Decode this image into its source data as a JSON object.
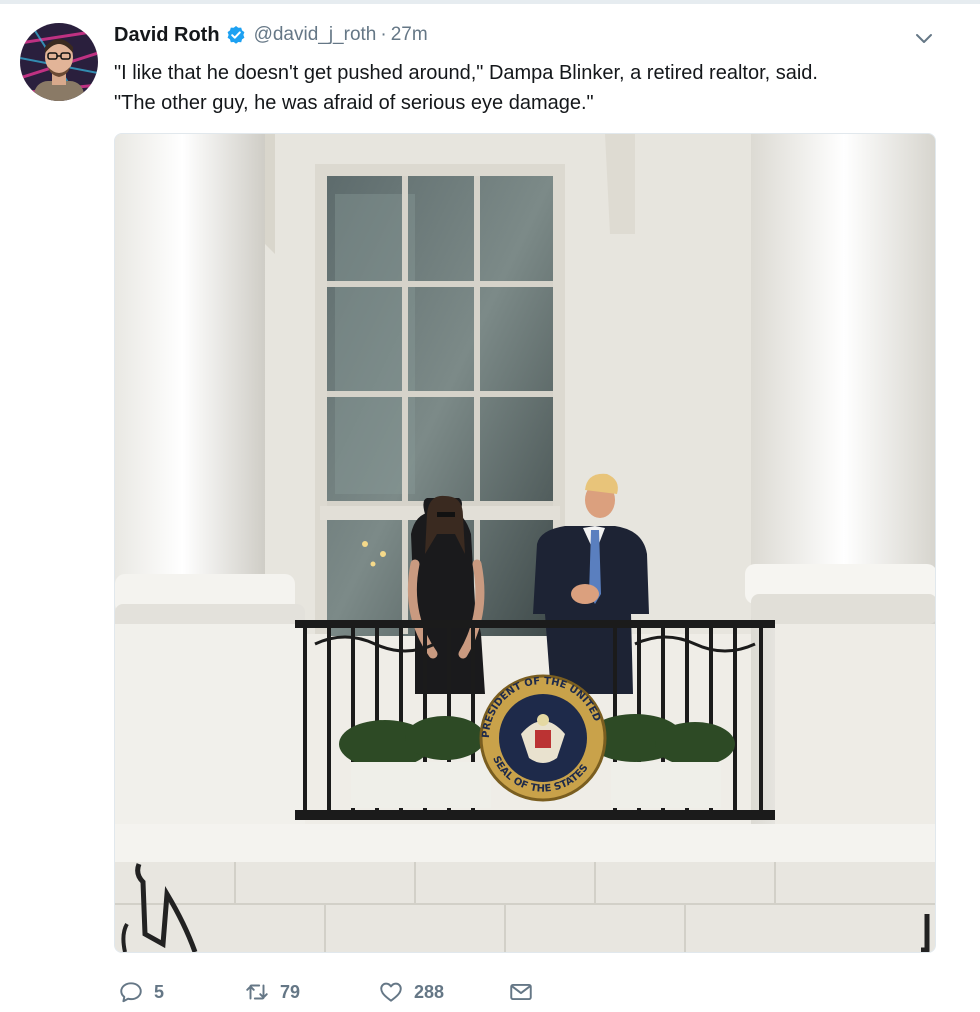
{
  "tweet": {
    "author_name": "David Roth",
    "handle": "@david_j_roth",
    "separator": "·",
    "time": "27m",
    "text_lines": [
      "\"I like that he doesn't get pushed around,\" Dampa Blinker, a retired realtor, said.",
      "\"The other guy, he was afraid of serious eye damage.\""
    ]
  },
  "seal": {
    "text_top": "PRESIDENT OF THE UNITED",
    "text_bottom": "SEAL OF THE STATES"
  },
  "actions": {
    "replies": "5",
    "retweets": "79",
    "likes": "288"
  },
  "icons": {
    "verified": "verified-badge-icon",
    "caret": "chevron-down-icon",
    "reply": "reply-icon",
    "retweet": "retweet-icon",
    "like": "heart-icon",
    "dm": "envelope-icon"
  },
  "colors": {
    "text": "#14171a",
    "secondary": "#657786",
    "verified": "#1da1f2",
    "seal_gold": "#c9a24a",
    "seal_navy": "#1e2a4a"
  }
}
